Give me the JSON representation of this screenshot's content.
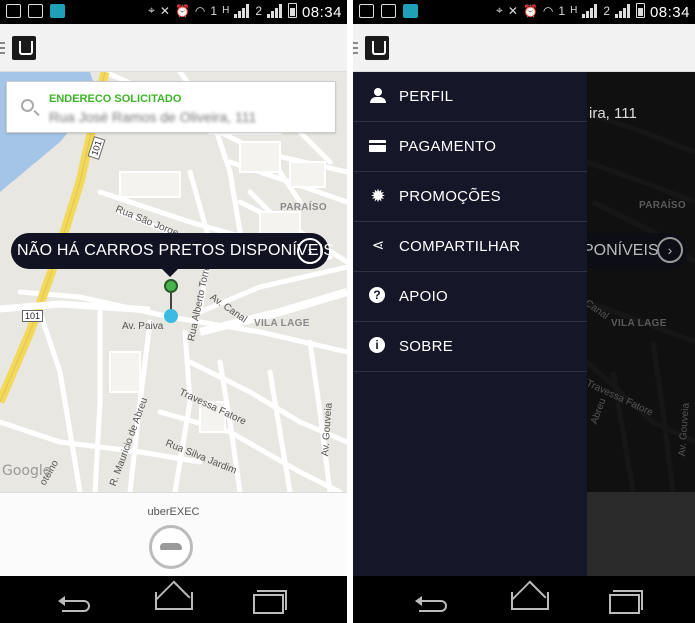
{
  "status_bar": {
    "time": "08:34",
    "sim1_label": "1",
    "sim2_label": "2",
    "network_label": "H"
  },
  "map": {
    "address_label": "ENDERECO SOLICITADO",
    "address_value": "Rua José Ramos de Oliveira, 111",
    "callout_text": "NÃO HÁ CARROS PRETOS DISPONÍVEIS",
    "streets": {
      "rua_sao_jorge": "Rua São Jorge",
      "av_paiva": "Av. Paiva",
      "rua_alberto_torres": "Rua Alberto Torres",
      "av_canal": "Av. Canal",
      "travessa_fatore": "Travessa Fatore",
      "rua_silva_jardim": "Rua Silva Jardim",
      "r_mauricio_abreu": "R. Mauricio de Abreu",
      "av_gouveia": "Av. Gouveia",
      "av_abreu": "Av. Abreu",
      "otelho": "otelho"
    },
    "districts": {
      "paraiso": "PARAÍSO",
      "vila_lage": "VILA LAGE"
    },
    "route_shield_1": "101",
    "route_shield_2": "101",
    "attribution": "Google"
  },
  "vehicle": {
    "label": "uberEXEC"
  },
  "drawer_view": {
    "address_fragment": "ira, 111",
    "callout_fragment": "PONÍVEIS",
    "menu": [
      {
        "label": "PERFIL",
        "icon": "person-icon"
      },
      {
        "label": "PAGAMENTO",
        "icon": "credit-card-icon"
      },
      {
        "label": "PROMOÇÕES",
        "icon": "promo-badge-icon"
      },
      {
        "label": "COMPARTILHAR",
        "icon": "share-icon"
      },
      {
        "label": "APOIO",
        "icon": "help-icon"
      },
      {
        "label": "SOBRE",
        "icon": "info-icon"
      }
    ],
    "districts": {
      "paraiso": "PARAÍSO",
      "vila_lage": "VILA LAGE"
    },
    "streets": {
      "canal": "Canal",
      "travessa_fatore": "Travessa Fatore",
      "av_gouveia": "Av. Gouveia",
      "abreu": "Abreu"
    }
  },
  "colors": {
    "accent_green": "#3db528",
    "drawer_bg": "#151728",
    "callout_bg": "#111322",
    "pickup_pin": "#48b34a",
    "location_dot": "#3bbbe0",
    "road_yellow": "#f2d95c"
  }
}
